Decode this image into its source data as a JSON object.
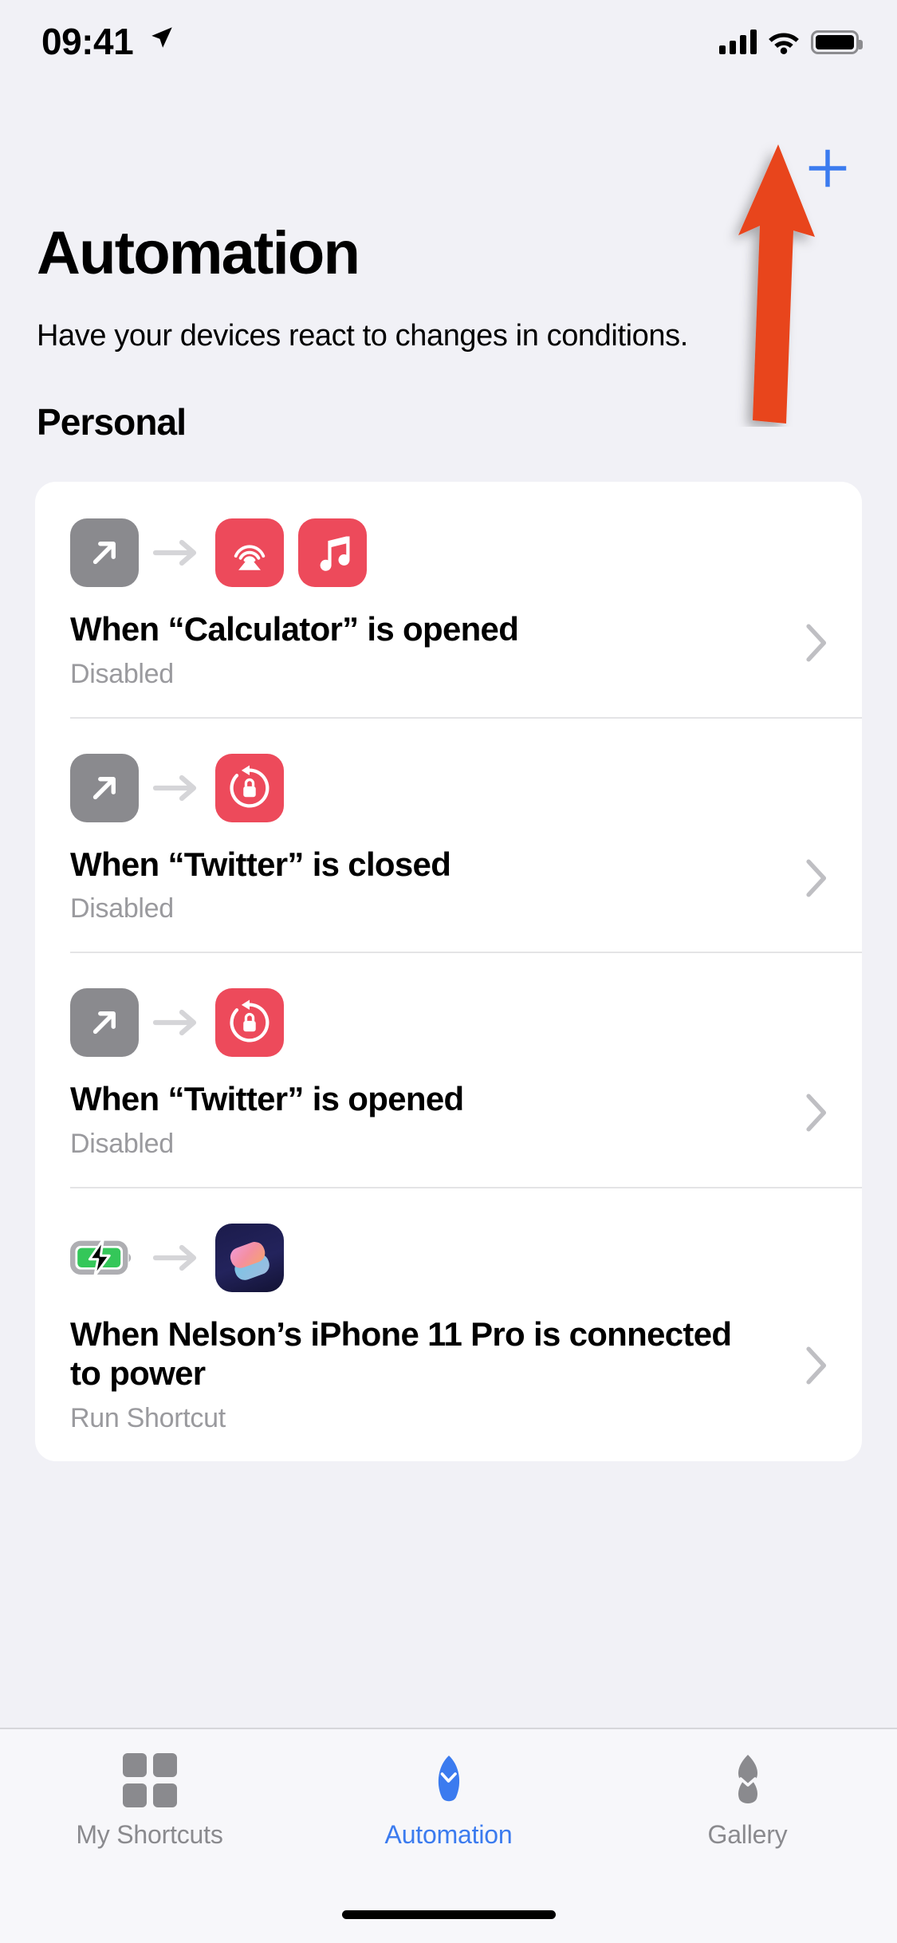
{
  "status_bar": {
    "time": "09:41",
    "location_icon": "location-arrow-icon",
    "cellular_icon": "cellular-bars-icon",
    "wifi_icon": "wifi-icon",
    "battery_icon": "battery-full-icon"
  },
  "header": {
    "add_button_label": "+",
    "add_button_icon": "plus-icon",
    "add_button_color": "#3B7BEF",
    "title": "Automation",
    "subtitle": "Have your devices react to changes in conditions."
  },
  "section": {
    "title": "Personal"
  },
  "annotation": {
    "type": "arrow",
    "color": "#E8441F",
    "points_to": "add-automation-button"
  },
  "automations": [
    {
      "trigger_icon": "app-opened-icon",
      "trigger_icon_color": "#8A8A8E",
      "action_icons": [
        "airplay-icon",
        "music-note-icon"
      ],
      "action_icon_color": "#ED4A5B",
      "title": "When “Calculator” is opened",
      "status": "Disabled",
      "chevron_icon": "chevron-right-icon"
    },
    {
      "trigger_icon": "app-opened-icon",
      "trigger_icon_color": "#8A8A8E",
      "action_icons": [
        "rotation-lock-icon"
      ],
      "action_icon_color": "#ED4A5B",
      "title": "When “Twitter” is closed",
      "status": "Disabled",
      "chevron_icon": "chevron-right-icon"
    },
    {
      "trigger_icon": "app-opened-icon",
      "trigger_icon_color": "#8A8A8E",
      "action_icons": [
        "rotation-lock-icon"
      ],
      "action_icon_color": "#ED4A5B",
      "title": "When “Twitter” is opened",
      "status": "Disabled",
      "chevron_icon": "chevron-right-icon"
    },
    {
      "trigger_icon": "battery-charging-icon",
      "trigger_icon_color": "#34C759",
      "action_icons": [
        "shortcuts-app-icon"
      ],
      "action_icon_color": "#1B1B4B",
      "title": "When Nelson’s iPhone 11 Pro is connected to power",
      "status": "Run Shortcut",
      "chevron_icon": "chevron-right-icon"
    }
  ],
  "tab_bar": {
    "tabs": [
      {
        "label": "My Shortcuts",
        "icon": "grid-squares-icon",
        "active": false
      },
      {
        "label": "Automation",
        "icon": "automation-check-icon",
        "active": true
      },
      {
        "label": "Gallery",
        "icon": "gallery-stack-icon",
        "active": false
      }
    ],
    "active_color": "#3B7BEF",
    "inactive_color": "#8A8A8E"
  }
}
